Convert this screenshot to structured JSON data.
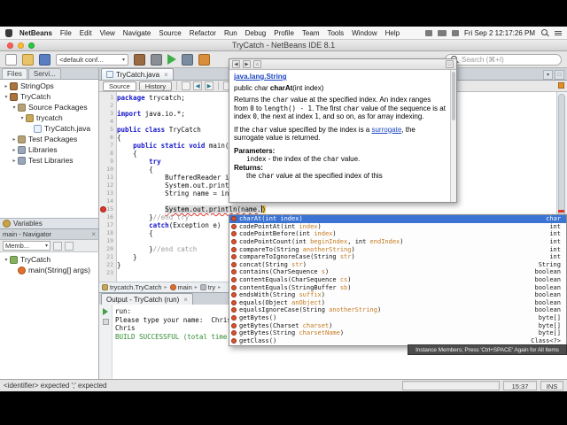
{
  "glyphs": {
    "close": "×",
    "chev": "▸",
    "down": "▾",
    "back": "◀",
    "fwd": "▶",
    "home": "⌂",
    "box": "□"
  },
  "menubar": {
    "app_name": "NetBeans",
    "menus": [
      "File",
      "Edit",
      "View",
      "Navigate",
      "Source",
      "Refactor",
      "Run",
      "Debug",
      "Profile",
      "Team",
      "Tools",
      "Window",
      "Help"
    ],
    "clock": "Fri Sep 2 12:17:26 PM"
  },
  "window": {
    "title": "TryCatch - NetBeans IDE 8.1"
  },
  "toolbar": {
    "config_value": "<default conf...",
    "search_placeholder": "Search (⌘+I)"
  },
  "sidebar": {
    "tabs": [
      "Files",
      "Servi..."
    ],
    "projects": [
      {
        "label": "StringOps",
        "indent": 0,
        "arrow": "▸",
        "icon": "project"
      },
      {
        "label": "TryCatch",
        "indent": 0,
        "arrow": "▾",
        "icon": "project"
      },
      {
        "label": "Source Packages",
        "indent": 1,
        "arrow": "▾",
        "icon": "pkgroot"
      },
      {
        "label": "trycatch",
        "indent": 2,
        "arrow": "▾",
        "icon": "pkg"
      },
      {
        "label": "TryCatch.java",
        "indent": 3,
        "arrow": " ",
        "icon": "java"
      },
      {
        "label": "Test Packages",
        "indent": 1,
        "arrow": "▸",
        "icon": "pkgroot"
      },
      {
        "label": "Libraries",
        "indent": 1,
        "arrow": "▸",
        "icon": "lib"
      },
      {
        "label": "Test Libraries",
        "indent": 1,
        "arrow": "▸",
        "icon": "lib"
      }
    ],
    "variables_pane_label": "Variables",
    "navigator": {
      "title": "main - Navigator",
      "filter_value": "Memb...",
      "members": [
        {
          "label": "TryCatch",
          "indent": 0,
          "arrow": "▾",
          "icon": "class"
        },
        {
          "label": "main(String[] args)",
          "indent": 1,
          "arrow": " ",
          "icon": "method"
        }
      ]
    }
  },
  "editor": {
    "tab_label": "TryCatch.java",
    "view_buttons": [
      "Source",
      "History"
    ],
    "error_line": 15,
    "lines": [
      {
        "n": 1,
        "seg": [
          [
            "kw",
            "package"
          ],
          [
            "pl",
            " trycatch;"
          ]
        ]
      },
      {
        "n": 2,
        "seg": []
      },
      {
        "n": 3,
        "seg": [
          [
            "kw",
            "import"
          ],
          [
            "pl",
            " java.io.*;"
          ]
        ]
      },
      {
        "n": 4,
        "seg": []
      },
      {
        "n": 5,
        "seg": [
          [
            "kw",
            "public"
          ],
          [
            "pl",
            " "
          ],
          [
            "kw",
            "class"
          ],
          [
            "pl",
            " TryCatch"
          ]
        ]
      },
      {
        "n": 6,
        "seg": [
          [
            "pl",
            "{"
          ]
        ]
      },
      {
        "n": 7,
        "seg": [
          [
            "pl",
            "    "
          ],
          [
            "kw",
            "public"
          ],
          [
            "pl",
            " "
          ],
          [
            "kw",
            "static"
          ],
          [
            "pl",
            " "
          ],
          [
            "kw",
            "void"
          ],
          [
            "pl",
            " main(St"
          ]
        ]
      },
      {
        "n": 8,
        "seg": [
          [
            "pl",
            "    {"
          ]
        ]
      },
      {
        "n": 9,
        "seg": [
          [
            "pl",
            "        "
          ],
          [
            "kw",
            "try"
          ]
        ]
      },
      {
        "n": 10,
        "seg": [
          [
            "pl",
            "        {"
          ]
        ]
      },
      {
        "n": 11,
        "seg": [
          [
            "pl",
            "            BufferedReader in"
          ]
        ]
      },
      {
        "n": 12,
        "seg": [
          [
            "pl",
            "            System.out.print("
          ],
          [
            "str",
            "\""
          ]
        ]
      },
      {
        "n": 13,
        "seg": [
          [
            "pl",
            "            String name = in."
          ]
        ]
      },
      {
        "n": 14,
        "seg": []
      },
      {
        "n": 15,
        "seg": [
          [
            "pl",
            "            "
          ],
          [
            "err",
            "System.out.println(name."
          ],
          [
            "caret",
            ""
          ],
          [
            "brc",
            ")"
          ]
        ]
      },
      {
        "n": 16,
        "seg": [
          [
            "pl",
            "        }"
          ],
          [
            "cmt",
            "//end try"
          ]
        ]
      },
      {
        "n": 17,
        "seg": [
          [
            "pl",
            "        "
          ],
          [
            "kw",
            "catch"
          ],
          [
            "pl",
            "(Exception e)"
          ]
        ]
      },
      {
        "n": 18,
        "seg": [
          [
            "pl",
            "        {"
          ]
        ]
      },
      {
        "n": 19,
        "seg": []
      },
      {
        "n": 20,
        "seg": [
          [
            "pl",
            "        }"
          ],
          [
            "cmt",
            "//end catch"
          ]
        ]
      },
      {
        "n": 21,
        "seg": [
          [
            "pl",
            "    }"
          ]
        ]
      },
      {
        "n": 22,
        "seg": [
          [
            "pl",
            "}"
          ]
        ]
      },
      {
        "n": 23,
        "seg": []
      }
    ]
  },
  "breadcrumbs": [
    {
      "label": "trycatch.TryCatch",
      "icon": "pkg"
    },
    {
      "label": "main",
      "icon": "method"
    },
    {
      "label": "try",
      "icon": "block"
    }
  ],
  "doc_popup": {
    "type_link": "java.lang.String",
    "signature": [
      [
        "t",
        "public char "
      ],
      [
        "b",
        "charAt"
      ],
      [
        "t",
        "(int index)"
      ]
    ],
    "paragraphs": [
      {
        "cls": "p",
        "seg": [
          [
            "t",
            "Returns the "
          ],
          [
            "c",
            "char"
          ],
          [
            "t",
            " value at the specified index. An index ranges from "
          ],
          [
            "c",
            "0"
          ],
          [
            "t",
            " to "
          ],
          [
            "c",
            "length() - 1"
          ],
          [
            "t",
            ". The first "
          ],
          [
            "c",
            "char"
          ],
          [
            "t",
            " value of the sequence is at index "
          ],
          [
            "c",
            "0"
          ],
          [
            "t",
            ", the next at index "
          ],
          [
            "c",
            "1"
          ],
          [
            "t",
            ", and so on, as for array indexing."
          ]
        ]
      },
      {
        "cls": "p",
        "seg": [
          [
            "t",
            "If the "
          ],
          [
            "c",
            "char"
          ],
          [
            "t",
            " value specified by the index is a "
          ],
          [
            "lk",
            "surrogate"
          ],
          [
            "t",
            ", the surrogate value is returned."
          ]
        ]
      },
      {
        "cls": "headline",
        "seg": [
          [
            "t",
            "Parameters:"
          ]
        ]
      },
      {
        "cls": "indent",
        "seg": [
          [
            "c",
            "index"
          ],
          [
            "t",
            " - the index of the "
          ],
          [
            "c",
            "char"
          ],
          [
            "t",
            " value."
          ]
        ]
      },
      {
        "cls": "headline",
        "seg": [
          [
            "t",
            "Returns:"
          ]
        ]
      },
      {
        "cls": "indent",
        "seg": [
          [
            "t",
            "the "
          ],
          [
            "c",
            "char"
          ],
          [
            "t",
            " value at the specified index of this"
          ]
        ]
      }
    ]
  },
  "completion": {
    "items": [
      {
        "name": "charAt",
        "params": [
          {
            "ty": "int",
            "nm": "index"
          }
        ],
        "ret": "char",
        "selected": true
      },
      {
        "name": "codePointAt",
        "params": [
          {
            "ty": "int",
            "nm": "index"
          }
        ],
        "ret": "int"
      },
      {
        "name": "codePointBefore",
        "params": [
          {
            "ty": "int",
            "nm": "index"
          }
        ],
        "ret": "int"
      },
      {
        "name": "codePointCount",
        "params": [
          {
            "ty": "int",
            "nm": "beginIndex"
          },
          {
            "ty": "int",
            "nm": "endIndex"
          }
        ],
        "ret": "int"
      },
      {
        "name": "compareTo",
        "params": [
          {
            "ty": "String",
            "nm": "anotherString"
          }
        ],
        "ret": "int"
      },
      {
        "name": "compareToIgnoreCase",
        "params": [
          {
            "ty": "String",
            "nm": "str"
          }
        ],
        "ret": "int"
      },
      {
        "name": "concat",
        "params": [
          {
            "ty": "String",
            "nm": "str"
          }
        ],
        "ret": "String"
      },
      {
        "name": "contains",
        "params": [
          {
            "ty": "CharSequence",
            "nm": "s"
          }
        ],
        "ret": "boolean"
      },
      {
        "name": "contentEquals",
        "params": [
          {
            "ty": "CharSequence",
            "nm": "cs"
          }
        ],
        "ret": "boolean"
      },
      {
        "name": "contentEquals",
        "params": [
          {
            "ty": "StringBuffer",
            "nm": "sb"
          }
        ],
        "ret": "boolean"
      },
      {
        "name": "endsWith",
        "params": [
          {
            "ty": "String",
            "nm": "suffix"
          }
        ],
        "ret": "boolean"
      },
      {
        "name": "equals",
        "params": [
          {
            "ty": "Object",
            "nm": "anObject"
          }
        ],
        "ret": "boolean"
      },
      {
        "name": "equalsIgnoreCase",
        "params": [
          {
            "ty": "String",
            "nm": "anotherString"
          }
        ],
        "ret": "boolean"
      },
      {
        "name": "getBytes",
        "params": [],
        "ret": "byte[]"
      },
      {
        "name": "getBytes",
        "params": [
          {
            "ty": "Charset",
            "nm": "charset"
          }
        ],
        "ret": "byte[]"
      },
      {
        "name": "getBytes",
        "params": [
          {
            "ty": "String",
            "nm": "charsetName"
          }
        ],
        "ret": "byte[]"
      },
      {
        "name": "getClass",
        "params": [],
        "ret": "Class<?>"
      }
    ],
    "footer": "Instance Members; Press 'Ctrl+SPACE' Again for All Items"
  },
  "output": {
    "tab_label": "Output - TryCatch (run)",
    "lines": [
      {
        "text": "run:",
        "cls": "pl"
      },
      {
        "text": "Please type your name:  Chris",
        "cls": "pl"
      },
      {
        "text": "Chris",
        "cls": "pl"
      },
      {
        "text": "BUILD SUCCESSFUL (total time: 1",
        "cls": "ok"
      }
    ]
  },
  "statusbar": {
    "message": "<identifier> expected  ';' expected",
    "caret": "15:37",
    "mode": "INS"
  }
}
